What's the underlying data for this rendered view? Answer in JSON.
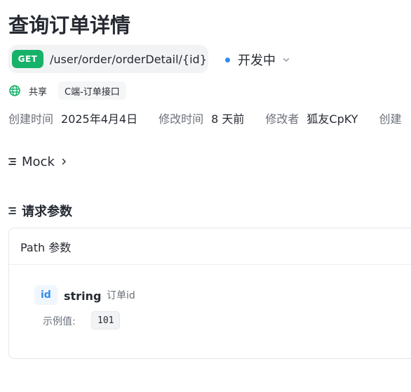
{
  "page": {
    "title": "查询订单详情"
  },
  "endpoint": {
    "method": "GET",
    "path": "/user/order/orderDetail/{id}"
  },
  "status": {
    "label": "开发中",
    "color": "#2f8cf0"
  },
  "sharing": {
    "icon": "globe-icon",
    "label": "共享",
    "folder": "C端-订单接口"
  },
  "meta": {
    "created_label": "创建时间",
    "created_value": "2025年4月4日",
    "modified_label": "修改时间",
    "modified_value": "8 天前",
    "modifier_label": "修改者",
    "modifier_value": "狐友CpKY",
    "creator_label": "创建"
  },
  "sections": {
    "mock_title": "Mock",
    "params_title": "请求参数"
  },
  "path_params": {
    "header": "Path 参数",
    "items": [
      {
        "name": "id",
        "type": "string",
        "description": "订单id",
        "example_label": "示例值:",
        "example_value": "101"
      }
    ]
  },
  "colors": {
    "get_badge": "#17b26a",
    "accent": "#2f8cf0"
  }
}
